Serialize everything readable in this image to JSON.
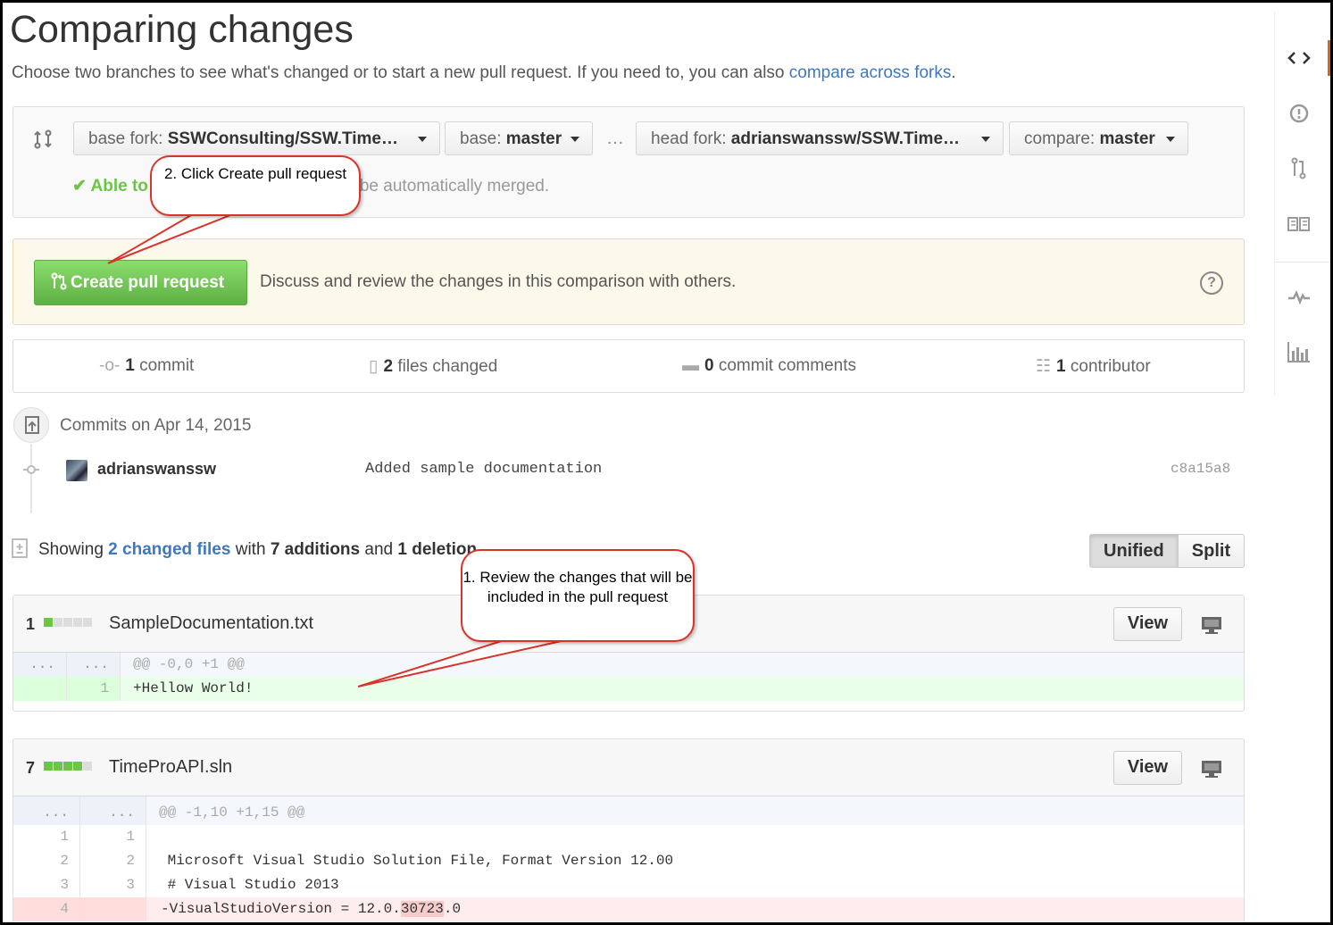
{
  "page": {
    "title": "Comparing changes",
    "subtitle_text": "Choose two branches to see what's changed or to start a new pull request. If you need to, you can also ",
    "subtitle_link": "compare across forks",
    "subtitle_end": "."
  },
  "range": {
    "base_fork_label": "base fork:",
    "base_fork_value": "SSWConsulting/SSW.Time…",
    "base_label": "base:",
    "base_value": "master",
    "separator": "…",
    "head_fork_label": "head fork:",
    "head_fork_value": "adrianswanssw/SSW.Time…",
    "compare_label": "compare:",
    "compare_value": "master",
    "merge_status_ok": "✔ Able to",
    "merge_status_rest": "an be automatically merged."
  },
  "pull_request": {
    "button_label": "Create pull request",
    "description": "Discuss and review the changes in this comparison with others.",
    "help_glyph": "?"
  },
  "stats": {
    "commits_count": "1",
    "commits_label": "commit",
    "files_count": "2",
    "files_label": "files changed",
    "comments_count": "0",
    "comments_label": "commit comments",
    "contributors_count": "1",
    "contributors_label": "contributor"
  },
  "commits": {
    "header": "Commits on Apr 14, 2015",
    "items": [
      {
        "author": "adrianswanssw",
        "message": "Added sample documentation",
        "sha": "c8a15a8"
      }
    ]
  },
  "summary": {
    "showing": "Showing",
    "changed_files": "2 changed files",
    "with": "with",
    "additions": "7 additions",
    "and": "and",
    "deletions": "1 deletion"
  },
  "view_toggle": {
    "unified": "Unified",
    "split": "Split"
  },
  "files": [
    {
      "count": "1",
      "name": "SampleDocumentation.txt",
      "view_label": "View",
      "diffstat_added": 1,
      "lines": [
        {
          "type": "hunk",
          "old": "...",
          "new": "...",
          "code": "@@ -0,0 +1 @@"
        },
        {
          "type": "add",
          "old": "",
          "new": "1",
          "code": "+Hellow World!"
        }
      ]
    },
    {
      "count": "7",
      "name": "TimeProAPI.sln",
      "view_label": "View",
      "diffstat_added": 4,
      "lines": [
        {
          "type": "hunk",
          "old": "...",
          "new": "...",
          "code": "@@ -1,10 +1,15 @@"
        },
        {
          "type": "ctx",
          "old": "1",
          "new": "1",
          "code": ""
        },
        {
          "type": "ctx",
          "old": "2",
          "new": "2",
          "code": " Microsoft Visual Studio Solution File, Format Version 12.00"
        },
        {
          "type": "ctx",
          "old": "3",
          "new": "3",
          "code": " # Visual Studio 2013"
        },
        {
          "type": "del",
          "old": "4",
          "new": "",
          "code_pre": "-VisualStudioVersion = 12.0.",
          "code_hl": "30723",
          "code_post": ".0"
        }
      ]
    }
  ],
  "callouts": {
    "create": "2. Click Create pull request",
    "review": "1. Review the changes that will be included in the pull request"
  },
  "sidenav": [
    "code-icon",
    "issues-icon",
    "pull-request-icon",
    "wiki-icon",
    "pulse-icon",
    "graphs-icon"
  ],
  "colors": {
    "link": "#4078c0",
    "green_button": "#60b044",
    "callout_border": "#d9342b",
    "addition": "#eaffea",
    "deletion": "#ffecec",
    "active_tab": "#d26911"
  }
}
